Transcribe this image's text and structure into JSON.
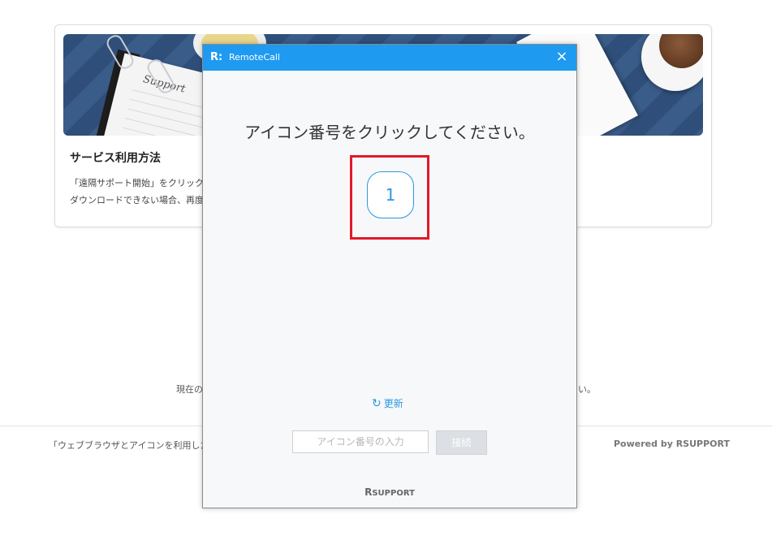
{
  "background": {
    "banner_text": "Support",
    "card_title": "サービス利用方法",
    "card_desc_line1": "「遠隔サポート開始」をクリックす",
    "card_desc_line2": "ダウンロードできない場合、再度",
    "notice_fragment": "現在の",
    "notice_tail": "い。",
    "footer_left": "「ウェブブラウザとアイコンを利用した",
    "footer_right": "Powered by RSUPPORT"
  },
  "dialog": {
    "logo": "R:",
    "title": "RemoteCall",
    "close_icon": "×",
    "instruction": "アイコン番号をクリックしてください。",
    "icon_number": "1",
    "refresh_icon": "↻",
    "refresh_label": "更新",
    "input_placeholder": "アイコン番号の入力",
    "input_value": "",
    "connect_label": "接続",
    "brand_r": "R",
    "brand_name": "SUPPORT"
  },
  "colors": {
    "titlebar": "#1e9bf0",
    "accent": "#2b98e4",
    "highlight": "#e0192a",
    "connect_disabled": "#dcdfe3"
  }
}
